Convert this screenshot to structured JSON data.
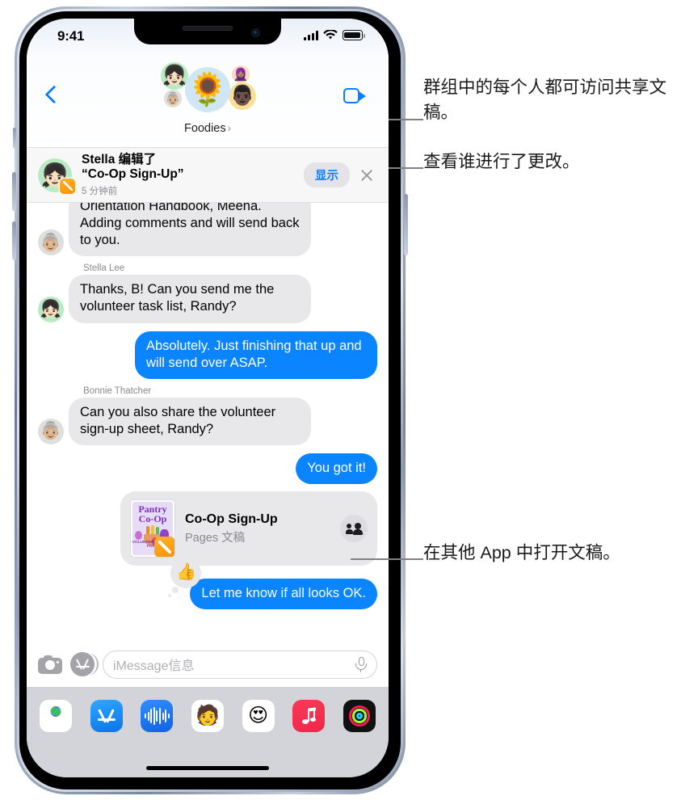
{
  "statusbar": {
    "time": "9:41",
    "signal_icon": "cellular-bars-icon",
    "wifi_icon": "wifi-icon",
    "battery_icon": "battery-full-icon"
  },
  "navbar": {
    "back_icon": "back-chevron-icon",
    "facetime_icon": "facetime-video-icon",
    "group_name": "Foodies",
    "group_chevron": "›",
    "avatars": [
      {
        "name": "group-avatar-sunflower",
        "glyph": "🌻",
        "bg": "#cfe6f7"
      },
      {
        "name": "group-avatar-stella",
        "glyph": "👧🏻",
        "bg": "#b8ebc4"
      },
      {
        "name": "group-avatar-bonnie",
        "glyph": "👵🏼",
        "bg": "#dededc"
      },
      {
        "name": "group-avatar-member-3",
        "glyph": "🧕🏽",
        "bg": "#f7d9c2"
      },
      {
        "name": "group-avatar-member-4",
        "glyph": "👨🏿",
        "bg": "#fae096"
      }
    ]
  },
  "notification": {
    "avatar_glyph": "👧🏻",
    "line1": "Stella 编辑了",
    "line2": "“Co-Op Sign-Up”",
    "timestamp": "5 分钟前",
    "show_label": "显示",
    "close_icon": "close-x-icon",
    "badge_icon": "pages-app-badge-icon"
  },
  "conversation": {
    "messages": [
      {
        "type": "incoming-clipped",
        "avatar_glyph": "👵🏼",
        "avatar_bg": "#dededc",
        "text": "Adding comments and will send back to you.",
        "clipped_text": "Orientation Handbook, Meena."
      },
      {
        "type": "incoming",
        "sender": "Stella Lee",
        "avatar_glyph": "👧🏻",
        "avatar_bg": "#b8ebc4",
        "text": "Thanks, B! Can you send me the volunteer task list, Randy?"
      },
      {
        "type": "outgoing",
        "text": "Absolutely. Just finishing that up and will send over ASAP."
      },
      {
        "type": "incoming",
        "sender": "Bonnie Thatcher",
        "avatar_glyph": "👵🏼",
        "avatar_bg": "#dededc",
        "text": "Can you also share the volunteer sign-up sheet, Randy?"
      },
      {
        "type": "outgoing",
        "text": "You got it!"
      }
    ],
    "document_card": {
      "title": "Co-Op Sign-Up",
      "subtitle": "Pages 文稿",
      "thumb_line1": "Pantry",
      "thumb_line2": "Co-Op",
      "thumb_footer": "VOLUNTEER SIGN-UP FORM",
      "badge_icon": "pages-app-badge-icon",
      "people_icon": "people-collaboration-icon"
    },
    "last_message": {
      "type": "outgoing",
      "text": "Let me know if all looks OK.",
      "tapback_glyph": "👍",
      "tapback_icon": "thumbs-up-tapback-icon"
    }
  },
  "inputbar": {
    "camera_icon": "camera-icon",
    "appstore_icon": "app-store-icon",
    "placeholder": "iMessage信息",
    "mic_icon": "microphone-icon"
  },
  "drawer": {
    "apps": [
      {
        "name": "app-icon-photos",
        "label": "Photos"
      },
      {
        "name": "app-icon-app-store",
        "label": "App Store"
      },
      {
        "name": "app-icon-audio-message",
        "label": "Audio"
      },
      {
        "name": "app-icon-memoji",
        "label": "Memoji",
        "glyph": "🧑"
      },
      {
        "name": "app-icon-memoji-stickers",
        "label": "Memoji Stickers",
        "glyph": "😍"
      },
      {
        "name": "app-icon-music",
        "label": "Music"
      },
      {
        "name": "app-icon-fitness",
        "label": "Fitness"
      }
    ]
  },
  "annotations": {
    "a1": "群组中的每个人都可访问共享文稿。",
    "a2": "查看谁进行了更改。",
    "a3": "在其他 App 中打开文稿。"
  }
}
